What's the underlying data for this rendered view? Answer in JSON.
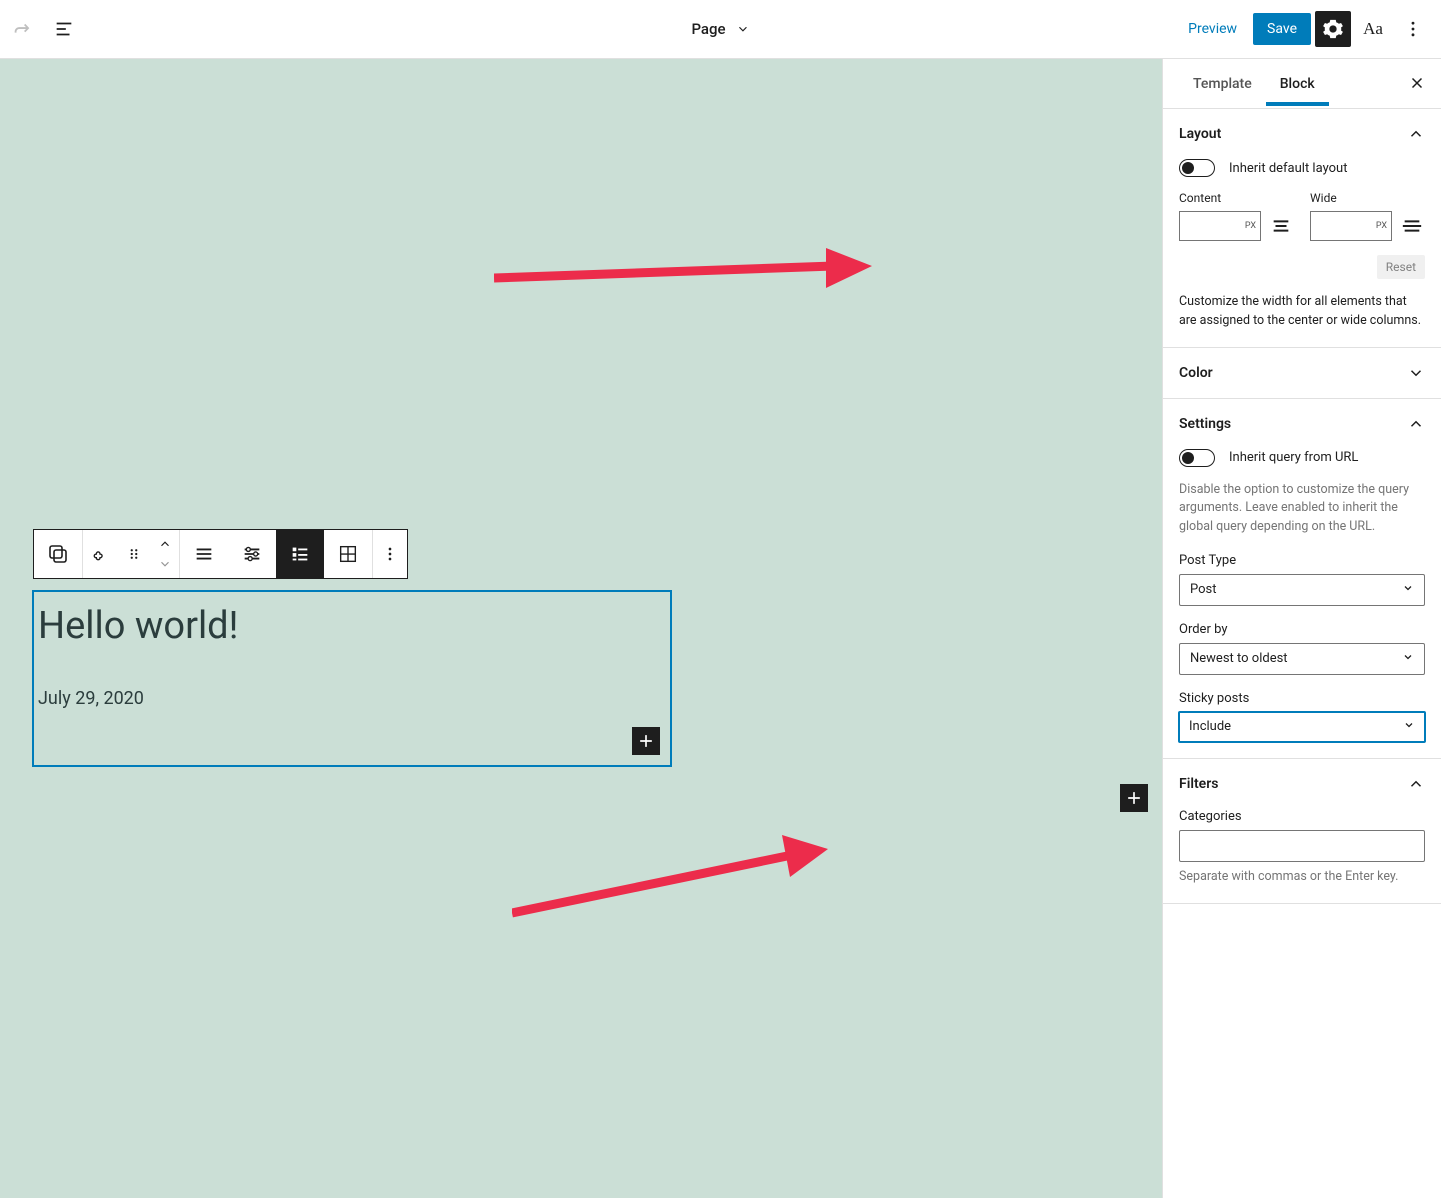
{
  "topbar": {
    "doc_type": "Page",
    "preview": "Preview",
    "save": "Save",
    "typography": "Aa"
  },
  "block": {
    "title": "Hello world!",
    "date": "July 29, 2020"
  },
  "sidebar": {
    "tabs": {
      "template": "Template",
      "block": "Block"
    },
    "layout": {
      "title": "Layout",
      "inherit_label": "Inherit default layout",
      "content_label": "Content",
      "wide_label": "Wide",
      "unit": "PX",
      "reset": "Reset",
      "help": "Customize the width for all elements that are assigned to the center or wide columns."
    },
    "color": {
      "title": "Color"
    },
    "settings": {
      "title": "Settings",
      "inherit_label": "Inherit query from URL",
      "inherit_help": "Disable the option to customize the query arguments. Leave enabled to inherit the global query depending on the URL.",
      "post_type_label": "Post Type",
      "post_type_value": "Post",
      "order_by_label": "Order by",
      "order_by_value": "Newest to oldest",
      "sticky_label": "Sticky posts",
      "sticky_value": "Include"
    },
    "filters": {
      "title": "Filters",
      "categories_label": "Categories",
      "categories_help": "Separate with commas or the Enter key."
    }
  }
}
